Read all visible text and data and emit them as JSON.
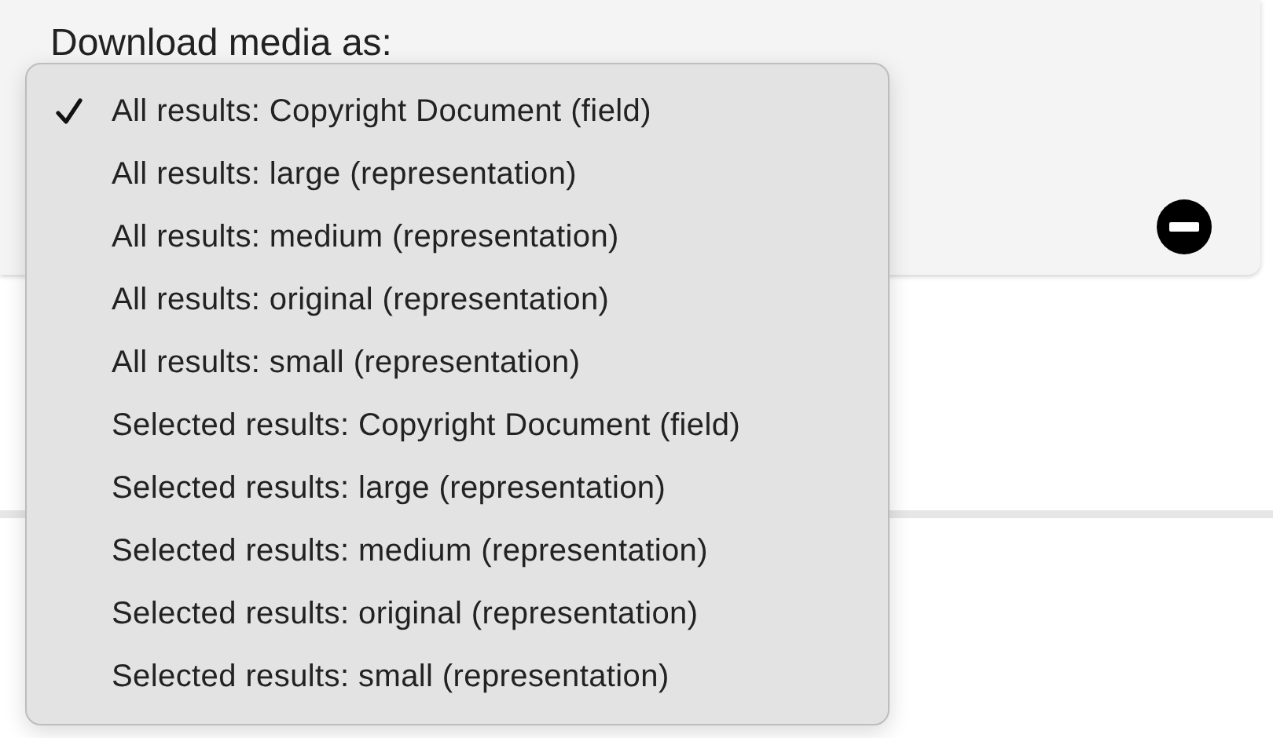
{
  "panel": {
    "title": "Download media as:"
  },
  "menu": {
    "items": [
      {
        "label": "All results: Copyright Document (field)",
        "selected": true
      },
      {
        "label": "All results: large (representation)",
        "selected": false
      },
      {
        "label": "All results: medium (representation)",
        "selected": false
      },
      {
        "label": "All results: original (representation)",
        "selected": false
      },
      {
        "label": "All results: small (representation)",
        "selected": false
      },
      {
        "label": "Selected results: Copyright Document (field)",
        "selected": false
      },
      {
        "label": "Selected results: large (representation)",
        "selected": false
      },
      {
        "label": "Selected results: medium (representation)",
        "selected": false
      },
      {
        "label": "Selected results: original (representation)",
        "selected": false
      },
      {
        "label": "Selected results: small (representation)",
        "selected": false
      }
    ]
  }
}
